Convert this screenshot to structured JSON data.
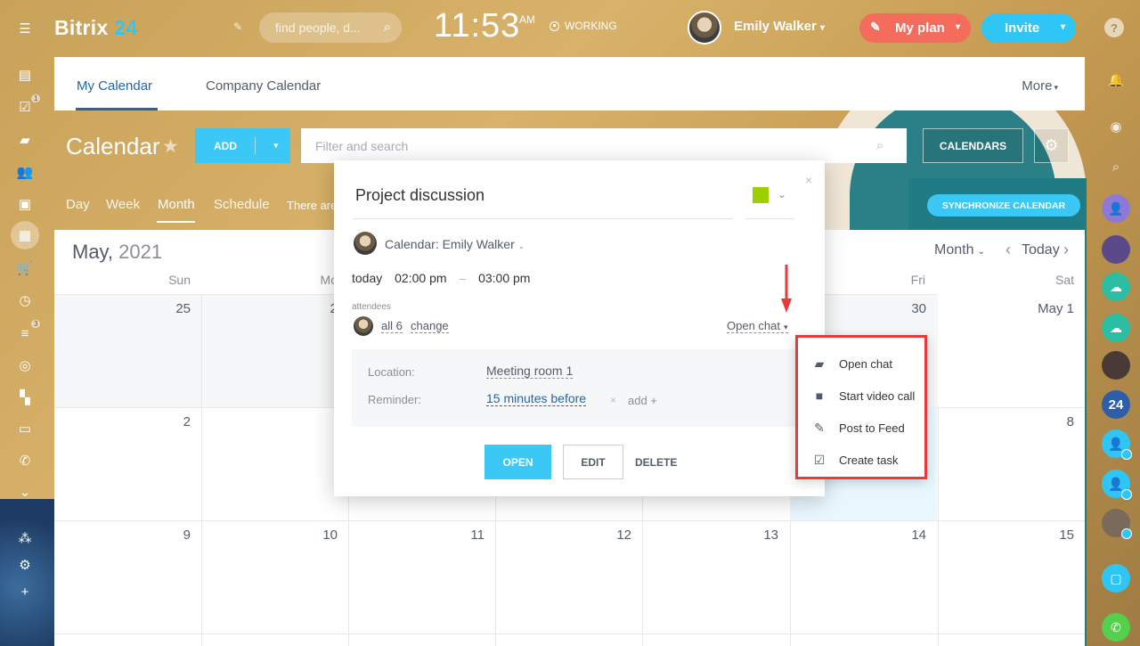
{
  "app": {
    "logo_text": "Bitrix",
    "logo_num": "24"
  },
  "topbar": {
    "search_placeholder": "find people, d...",
    "clock": "11:53",
    "clock_ampm": "AM",
    "status": "WORKING",
    "user_name": "Emily Walker",
    "my_plan": "My plan",
    "invite": "Invite"
  },
  "left_rail": {
    "badges": [
      "1",
      "3"
    ]
  },
  "right_rail": {
    "badge_24": "24"
  },
  "tabs": {
    "items": [
      "My Calendar",
      "Company Calendar"
    ],
    "more": "More"
  },
  "header": {
    "title": "Calendar",
    "add": "ADD",
    "filter_placeholder": "Filter and search",
    "calendars": "CALENDARS"
  },
  "views": {
    "items": [
      "Day",
      "Week",
      "Month",
      "Schedule"
    ],
    "active": "Month",
    "note": "There are",
    "sync": "SYNCHRONIZE CALENDAR"
  },
  "calendar": {
    "month": "May,",
    "year": "2021",
    "view_select": "Month",
    "today": "Today",
    "days_of_week": [
      "Sun",
      "Mo",
      "",
      "",
      "",
      "Fri",
      "Sat"
    ],
    "week1": [
      "25",
      "2",
      "",
      "",
      "",
      "30",
      "May 1"
    ],
    "week2": [
      "2",
      "",
      "",
      "",
      "",
      "",
      "8"
    ],
    "week3": [
      "9",
      "10",
      "11",
      "12",
      "13",
      "14",
      "15"
    ]
  },
  "popup": {
    "title": "Project discussion",
    "color": "#9dcf00",
    "calendar_label": "Calendar: Emily Walker",
    "date": "today",
    "time_from": "02:00 pm",
    "time_to": "03:00 pm",
    "attendees_label": "attendees",
    "attendees_all": "all 6",
    "attendees_change": "change",
    "open_chat": "Open chat",
    "location_label": "Location:",
    "location_value": "Meeting room 1",
    "reminder_label": "Reminder:",
    "reminder_value": "15 minutes before",
    "reminder_add": "add +",
    "btn_open": "OPEN",
    "btn_edit": "EDIT",
    "btn_delete": "DELETE"
  },
  "chat_menu": {
    "items": [
      {
        "label": "Open chat",
        "icon": "chat-icon"
      },
      {
        "label": "Start video call",
        "icon": "video-camera-icon"
      },
      {
        "label": "Post to Feed",
        "icon": "edit-icon"
      },
      {
        "label": "Create task",
        "icon": "checkbox-icon"
      }
    ]
  },
  "colors": {
    "accent_blue": "#2fc6f6",
    "myplan_red": "#f36c5c",
    "highlight_red": "#e93a3a"
  }
}
